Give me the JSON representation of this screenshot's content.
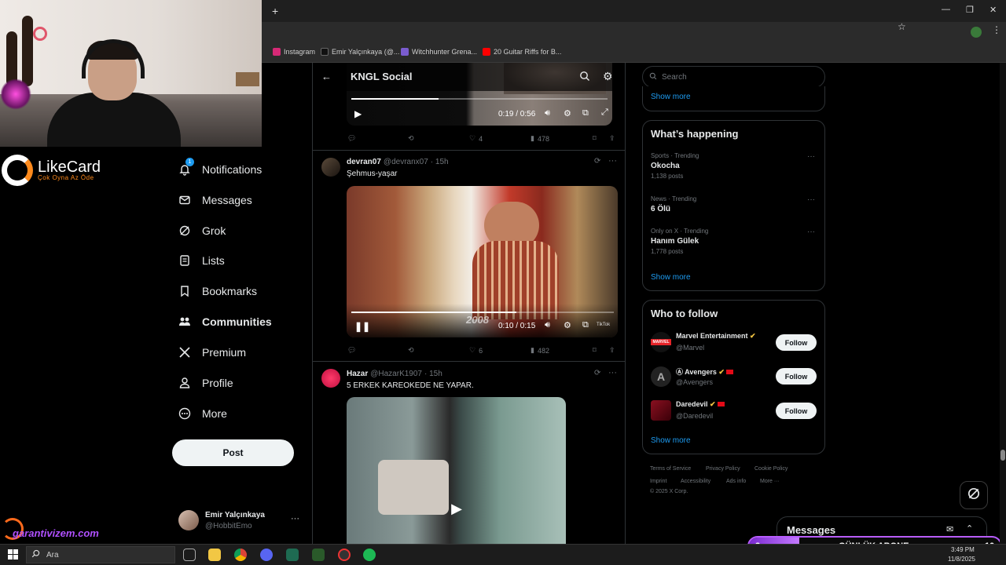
{
  "browser": {
    "new_tab": "+",
    "window_controls": {
      "minimize": "—",
      "maximize": "❐",
      "close": "✕"
    },
    "bookmarks": [
      {
        "label": "Instagram",
        "color": "#d62976"
      },
      {
        "label": "Emir Yalçınkaya (@...",
        "color": "#000000"
      },
      {
        "label": "Witchhunter Grena...",
        "color": "#7a5ccf"
      },
      {
        "label": "20 Guitar Riffs for B...",
        "color": "#ff0000"
      }
    ]
  },
  "overlay": {
    "likecard_name": "LikeCard",
    "likecard_tagline": "Çok Oyna  Az Öde",
    "watermark": "garantivizem.com"
  },
  "nav": {
    "notifications_badge": "1",
    "items": [
      {
        "label": "Notifications",
        "icon": "bell-icon"
      },
      {
        "label": "Messages",
        "icon": "mail-icon"
      },
      {
        "label": "Grok",
        "icon": "grok-icon"
      },
      {
        "label": "Lists",
        "icon": "list-icon"
      },
      {
        "label": "Bookmarks",
        "icon": "bookmark-icon"
      },
      {
        "label": "Communities",
        "icon": "communities-icon"
      },
      {
        "label": "Premium",
        "icon": "x-logo-icon"
      },
      {
        "label": "Profile",
        "icon": "person-icon"
      },
      {
        "label": "More",
        "icon": "more-circle-icon"
      }
    ],
    "post_label": "Post",
    "account": {
      "name": "Emir Yalçınkaya",
      "handle": "@HobbitEmo",
      "more": "···"
    }
  },
  "main": {
    "title": "KNGL Social",
    "tweet0": {
      "time": "0:19 / 0:56",
      "progress": 0.34,
      "likes": "4",
      "views": "478"
    },
    "tweet1": {
      "name": "devran07",
      "handle": "@devranx07",
      "age": "· 15h",
      "text": "Şehmus-yaşar",
      "time": "0:10 / 0:15",
      "progress": 0.63,
      "overlay_year": "2008",
      "overlay_tiktok": "TikTok",
      "likes": "6",
      "views": "482"
    },
    "tweet2": {
      "name": "Hazar",
      "handle": "@HazarK1907",
      "age": "· 15h",
      "text": "5 ERKEK KAREOKEDE NE YAPAR."
    }
  },
  "right": {
    "search_placeholder": "Search",
    "show_more_top": "Show more",
    "happening_title": "What’s happening",
    "trends": [
      {
        "meta": "Sports · Trending",
        "title": "Okocha",
        "count": "1,138 posts"
      },
      {
        "meta": "News · Trending",
        "title": "6 Ölü",
        "count": ""
      },
      {
        "meta": "Only on X · Trending",
        "title": "Hanım Gülek",
        "count": "1,778 posts"
      }
    ],
    "show_more_trends": "Show more",
    "wtf_title": "Who to follow",
    "follow": [
      {
        "name": "Marvel Entertainment",
        "handle": "@Marvel",
        "button": "Follow",
        "avatar": "MARVEL"
      },
      {
        "name": "Avengers",
        "handle": "@Avengers",
        "button": "Follow",
        "avatar": "A"
      },
      {
        "name": "Daredevil",
        "handle": "@Daredevil",
        "button": "Follow",
        "avatar": ""
      }
    ],
    "show_more_follow": "Show more",
    "footer": [
      "Terms of Service",
      "Privacy Policy",
      "Cookie Policy",
      "Imprint",
      "Accessibility",
      "Ads info",
      "More ···",
      "© 2025 X Corp."
    ],
    "messages_label": "Messages"
  },
  "stream_overlay": {
    "count": "2",
    "label": "GÜNLÜK ABONE",
    "goal": "10"
  },
  "taskbar": {
    "search_placeholder": "Ara",
    "time": "3:49 PM",
    "date": "11/8/2025"
  }
}
